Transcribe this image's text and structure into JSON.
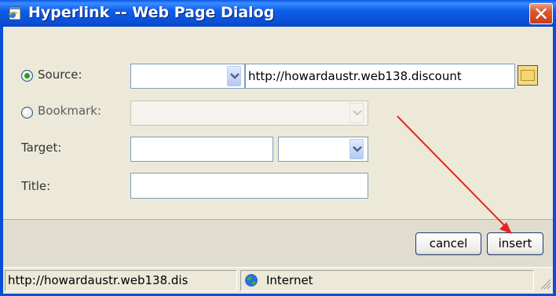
{
  "window": {
    "title": "Hyperlink -- Web Page Dialog",
    "close_glyph": "✕"
  },
  "form": {
    "source": {
      "label": "Source:",
      "selected": true,
      "protocol_value": "",
      "url_value": "http://howardaustr.web138.discount"
    },
    "bookmark": {
      "label": "Bookmark:",
      "selected": false,
      "value": ""
    },
    "target": {
      "label": "Target:",
      "value": "",
      "select_value": ""
    },
    "title": {
      "label": "Title:",
      "value": ""
    }
  },
  "buttons": {
    "cancel": "cancel",
    "insert": "insert"
  },
  "statusbar": {
    "url": "http://howardaustr.web138.dis",
    "zone": "Internet"
  },
  "annotation": {
    "color": "#e8231f"
  },
  "colors": {
    "title_bar": "#0a4fd6",
    "dialog_bg": "#ece9d8",
    "close_button": "#d9582f"
  }
}
